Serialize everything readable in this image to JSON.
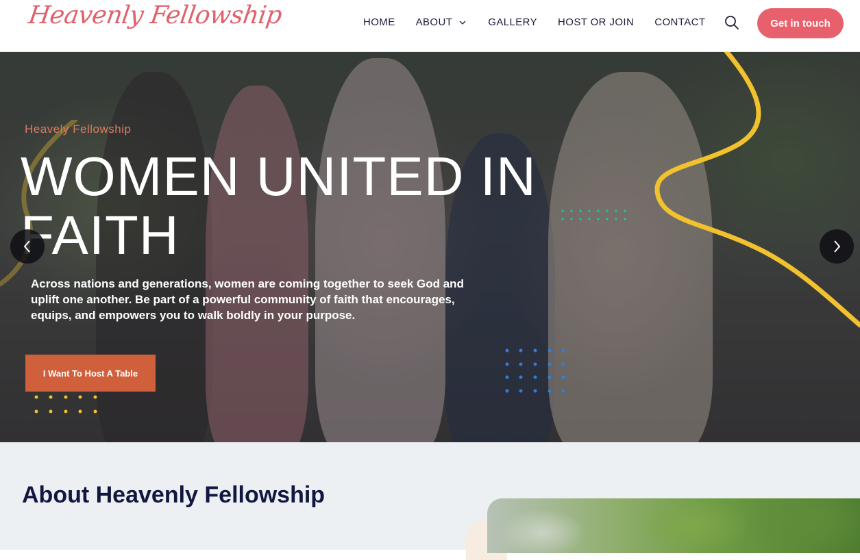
{
  "header": {
    "logo_text": "Heavenly Fellowship",
    "nav": [
      {
        "label": "HOME"
      },
      {
        "label": "ABOUT",
        "has_dropdown": true
      },
      {
        "label": "GALLERY"
      },
      {
        "label": "HOST OR JOIN"
      },
      {
        "label": "CONTACT"
      }
    ],
    "search_icon": "search-icon",
    "cta_label": "Get in touch"
  },
  "hero": {
    "subtitle": "Heavely Fellowship",
    "title": "WOMEN UNITED IN FAITH",
    "description": "Across nations and generations, women are coming together to seek God and uplift one another. Be part of a powerful community of faith that encourages, equips, and empowers you to walk boldly in your purpose.",
    "button_label": "I Want To Host A Table",
    "prev_icon": "chevron-left-icon",
    "next_icon": "chevron-right-icon"
  },
  "about": {
    "title": "About Heavenly Fellowship"
  },
  "colors": {
    "brand_pink": "#e8606b",
    "hero_button": "#d0603c",
    "navy": "#131740",
    "accent_yellow": "#f2c12e",
    "accent_teal": "#1fc7a0",
    "accent_blue": "#2d7fdd"
  }
}
